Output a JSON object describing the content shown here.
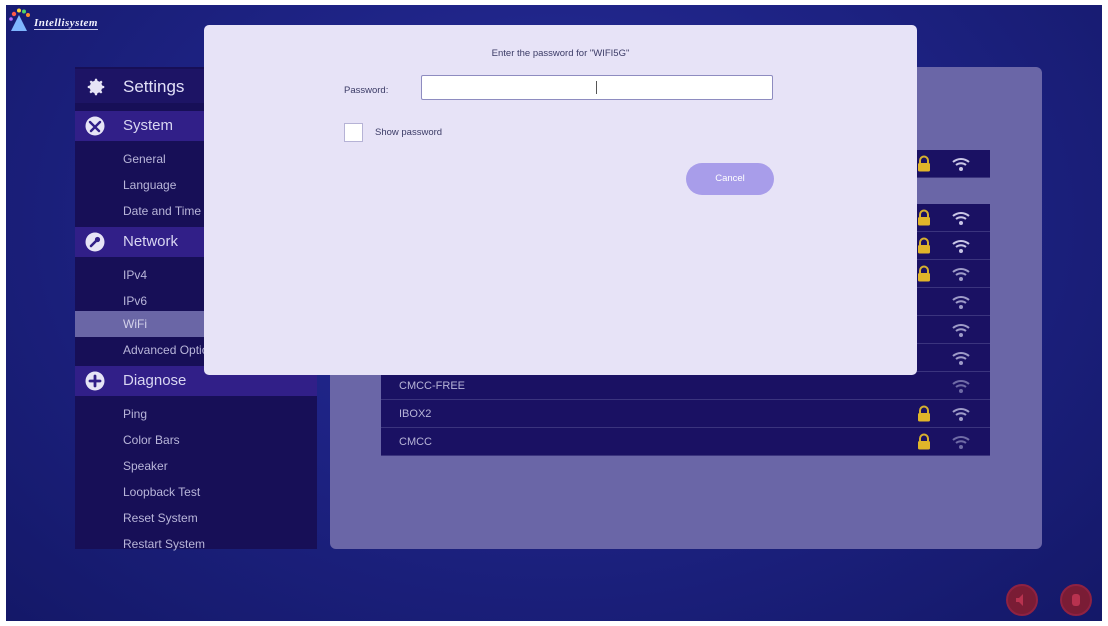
{
  "brand": {
    "logo_text": "Intellisystem"
  },
  "sidebar": {
    "title": "Settings",
    "sections": [
      {
        "label": "System",
        "icon": "tools-icon",
        "items": [
          "General",
          "Language",
          "Date and Time"
        ]
      },
      {
        "label": "Network",
        "icon": "wrench-icon",
        "items": [
          "IPv4",
          "IPv6",
          "WiFi",
          "Advanced Options"
        ]
      },
      {
        "label": "Diagnose",
        "icon": "plus-icon",
        "items": [
          "Ping",
          "Color Bars",
          "Speaker",
          "Loopback Test",
          "Reset System",
          "Restart System"
        ]
      }
    ],
    "active_item": "WiFi"
  },
  "networks": {
    "visible_rows": [
      {
        "name": "",
        "locked": true
      },
      {
        "name": "",
        "locked": true
      },
      {
        "name": "",
        "locked": true
      },
      {
        "name": "",
        "locked": true
      },
      {
        "name": "",
        "locked": false
      },
      {
        "name": "",
        "locked": false
      },
      {
        "name": "",
        "locked": false
      },
      {
        "name": "CMCC-FREE",
        "locked": false
      },
      {
        "name": "IBOX2",
        "locked": true
      },
      {
        "name": "CMCC",
        "locked": true
      }
    ]
  },
  "dialog": {
    "title": "Enter the password for \"WIFI5G\"",
    "password_label": "Password:",
    "password_value": "",
    "show_password_label": "Show password",
    "show_password_checked": false,
    "cancel_label": "Cancel"
  },
  "colors": {
    "background": "#1e2385",
    "sidebar": "#170f57",
    "section_header": "#311f88",
    "dialog": "#e7e3f7",
    "cancel_button": "#a89dea",
    "round_buttons": "#7a1c35"
  }
}
